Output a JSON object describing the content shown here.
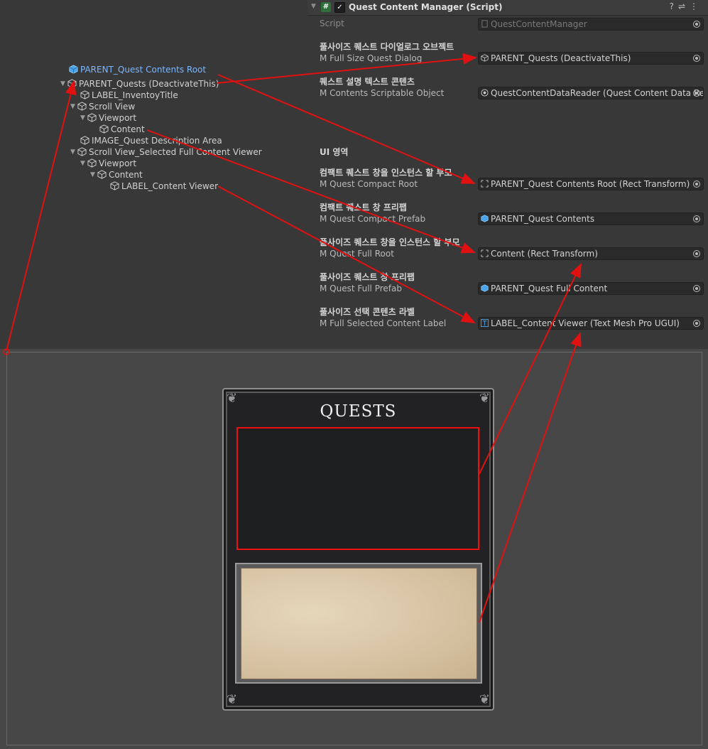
{
  "hierarchy": {
    "items": [
      {
        "label": "PARENT_Quest Contents Root"
      },
      {
        "label": "PARENT_Quests (DeactivateThis)"
      },
      {
        "label": "LABEL_InventoyTitle"
      },
      {
        "label": "Scroll View"
      },
      {
        "label": "Viewport"
      },
      {
        "label": "Content"
      },
      {
        "label": "IMAGE_Quest Description Area"
      },
      {
        "label": "Scroll View_Selected Full Content Viewer"
      },
      {
        "label": "Viewport"
      },
      {
        "label": "Content"
      },
      {
        "label": "LABEL_Content Viewer"
      }
    ]
  },
  "inspector": {
    "component_title": "Quest Content Manager (Script)",
    "script_label": "Script",
    "script_value": "QuestContentManager",
    "header_icons": [
      "help-icon",
      "preset-icon",
      "more-icon"
    ],
    "section_ui": "UI 영역",
    "properties": [
      {
        "title": "풀사이즈 퀘스트 다이얼로그 오브젝트",
        "label": "M Full Size Quest Dialog",
        "value": "PARENT_Quests (DeactivateThis)"
      },
      {
        "title": "퀘스트 설명 텍스트 콘텐츠",
        "label": "M Contents Scriptable Object",
        "value": "QuestContentDataReader (Quest Content Data Re"
      },
      {
        "title": "컴팩트 퀘스트 창을 인스턴스 할 부모",
        "label": "M Quest Compact Root",
        "value": "PARENT_Quest Contents Root (Rect Transform)"
      },
      {
        "title": "컴팩트 퀘스트 창 프리팹",
        "label": "M Quest Compact Prefab",
        "value": "PARENT_Quest Contents"
      },
      {
        "title": "풀사이즈 퀘스트 창을 인스턴스 할 부모",
        "label": "M Quest Full Root",
        "value": "Content (Rect Transform)"
      },
      {
        "title": "풀사이즈 퀘스트 창 프리팹",
        "label": "M Quest Full Prefab",
        "value": "PARENT_Quest Full Content"
      },
      {
        "title": "풀사이즈 선택 콘텐츠 라벨",
        "label": "M Full Selected Content Label",
        "value": "LABEL_Content Viewer (Text Mesh Pro UGUI)"
      }
    ]
  },
  "scene": {
    "panel_title": "QUESTS"
  },
  "colors": {
    "annotation_red": "#e11111",
    "hierarchy_selected_blue": "#7cb7ff",
    "parchment": "#dac8aa"
  }
}
